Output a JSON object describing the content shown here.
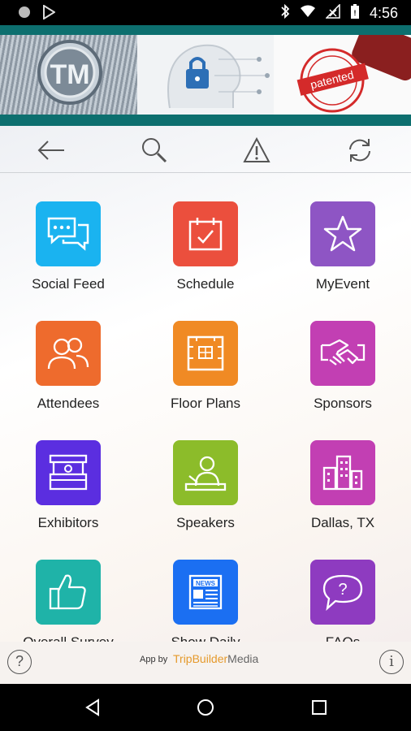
{
  "status_bar": {
    "time": "4:56",
    "icons": [
      "circle-icon",
      "play-store-icon",
      "bluetooth-icon",
      "wifi-icon",
      "no-signal-icon",
      "battery-icon"
    ]
  },
  "banner": {
    "tm_text": "TM",
    "stamp_text": "patented"
  },
  "toolbar": {
    "icons": [
      "back-arrow-icon",
      "search-icon",
      "alert-icon",
      "refresh-icon"
    ]
  },
  "tiles": [
    {
      "label": "Social Feed",
      "icon": "chat-bubbles-icon",
      "color": "#1ab3f0"
    },
    {
      "label": "Schedule",
      "icon": "calendar-check-icon",
      "color": "#eb4f3d"
    },
    {
      "label": "MyEvent",
      "icon": "star-icon",
      "color": "#8e55c4"
    },
    {
      "label": "Attendees",
      "icon": "people-icon",
      "color": "#ee6b2d"
    },
    {
      "label": "Floor Plans",
      "icon": "floor-plan-icon",
      "color": "#f08a24"
    },
    {
      "label": "Sponsors",
      "icon": "handshake-icon",
      "color": "#c23fb3"
    },
    {
      "label": "Exhibitors",
      "icon": "booth-icon",
      "color": "#5b2ee0"
    },
    {
      "label": "Speakers",
      "icon": "speaker-podium-icon",
      "color": "#8cbc2a"
    },
    {
      "label": "Dallas, TX",
      "icon": "city-buildings-icon",
      "color": "#c23fb3"
    },
    {
      "label": "Overall Survey",
      "icon": "thumbs-up-icon",
      "color": "#1fb3a8"
    },
    {
      "label": "Show Daily",
      "icon": "newspaper-icon",
      "color": "#1b6ff2"
    },
    {
      "label": "FAQs",
      "icon": "question-bubble-icon",
      "color": "#8e3bc0"
    }
  ],
  "footer": {
    "app_by": "App by",
    "brand_part1": "TripBuilder",
    "brand_part2": "Media",
    "help_glyph": "?",
    "info_glyph": "i"
  },
  "nav_bar": {
    "icons": [
      "back-triangle-icon",
      "home-circle-icon",
      "recents-square-icon"
    ]
  }
}
